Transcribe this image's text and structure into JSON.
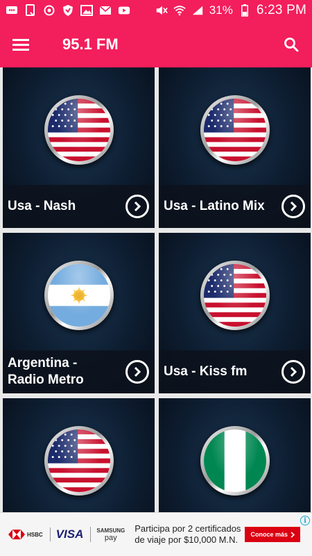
{
  "status_bar": {
    "battery": "31%",
    "time": "6:23 PM"
  },
  "app_bar": {
    "title": "95.1 FM"
  },
  "stations": [
    {
      "name": "Usa - Nash",
      "flag": "usa-flag-icon"
    },
    {
      "name": "Usa - Latino Mix",
      "flag": "usa-flag-icon"
    },
    {
      "name": "Argentina - Radio Metro",
      "flag": "argentina-flag-icon"
    },
    {
      "name": "Usa - Kiss fm",
      "flag": "usa-flag-icon"
    },
    {
      "name": "",
      "flag": "usa-flag-icon"
    },
    {
      "name": "",
      "flag": "nigeria-flag-icon"
    }
  ],
  "ad": {
    "brand_bank": "HSBC",
    "brand_card": "VISA",
    "brand_pay_top": "SAMSUNG",
    "brand_pay_bottom": "pay",
    "text": "Participa por 2 certificados de viaje por $10,000 M.N.",
    "cta": "Conoce más",
    "info": "i",
    "cta_color": "#db0011"
  },
  "colors": {
    "accent": "#f31e5c",
    "card_bg": "#0d1d30"
  }
}
